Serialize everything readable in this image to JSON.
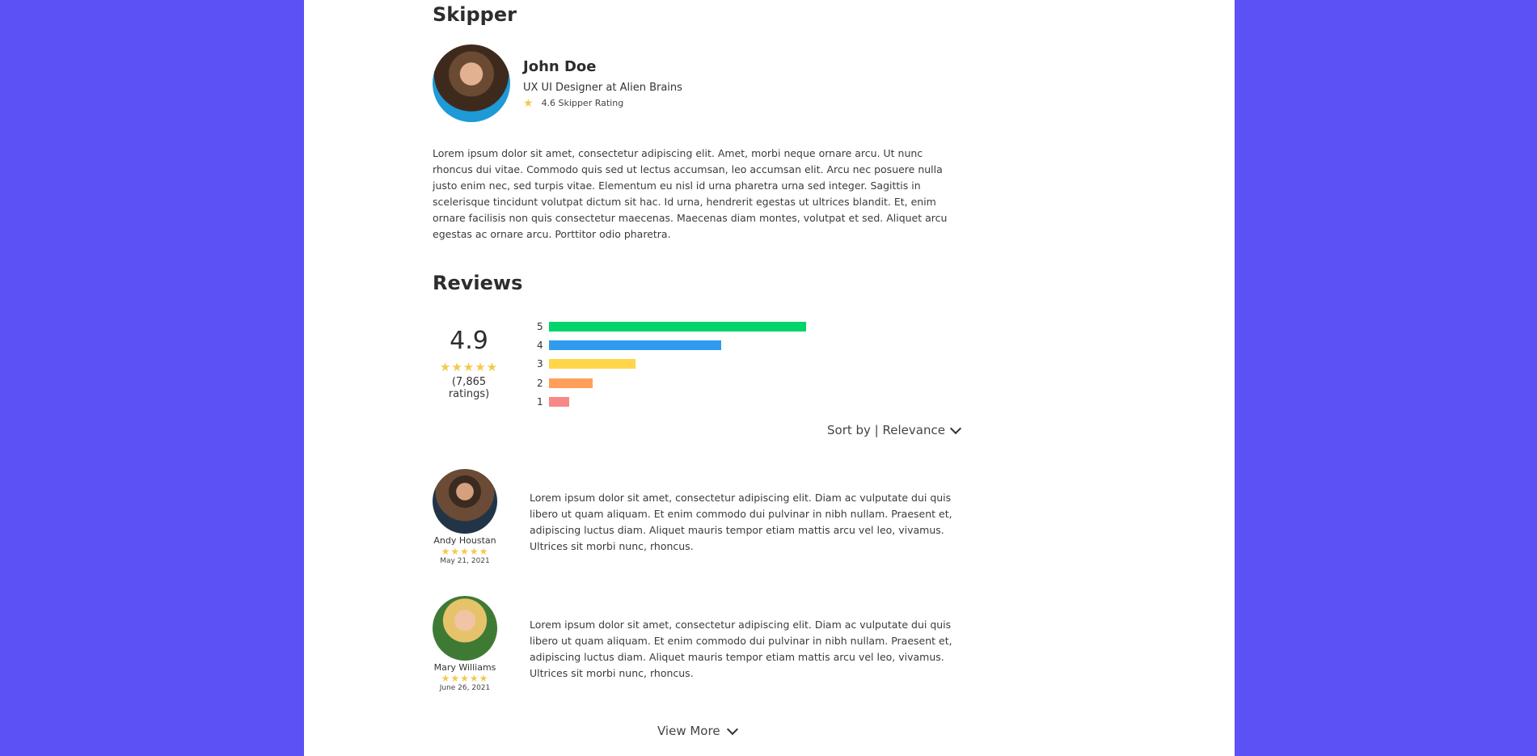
{
  "skipper": {
    "section_title": "Skipper",
    "name": "John Doe",
    "role": "UX UI Designer at Alien Brains",
    "rating_text": "4.6 Skipper Rating",
    "bio": "Lorem ipsum dolor sit amet, consectetur adipiscing elit. Amet, morbi neque ornare arcu. Ut nunc rhoncus dui vitae. Commodo quis sed ut lectus accumsan, leo accumsan elit. Arcu nec posuere nulla justo enim nec, sed turpis vitae. Elementum eu nisl id urna pharetra urna sed integer. Sagittis in scelerisque tincidunt volutpat dictum sit hac. Id urna, hendrerit egestas ut ultrices blandit. Et, enim ornare facilisis non quis consectetur maecenas. Maecenas diam montes, volutpat et sed. Aliquet arcu egestas ac ornare arcu. Porttitor odio pharetra."
  },
  "reviews": {
    "section_title": "Reviews",
    "average": "4.9",
    "stars": "★★★★★",
    "count": "(7,865 ratings)",
    "distribution": [
      {
        "label": "5",
        "fraction": 1.0,
        "color": "#00d46a"
      },
      {
        "label": "4",
        "fraction": 0.67,
        "color": "#2f9bef"
      },
      {
        "label": "3",
        "fraction": 0.335,
        "color": "#ffd54a"
      },
      {
        "label": "2",
        "fraction": 0.17,
        "color": "#ff9f5a"
      },
      {
        "label": "1",
        "fraction": 0.08,
        "color": "#f78888"
      }
    ],
    "sort_label": "Sort by | Relevance",
    "items": [
      {
        "name": "Andy Houstan",
        "stars": "★★★★★",
        "date": "May 21, 2021",
        "text": "Lorem ipsum dolor sit amet, consectetur adipiscing elit. Diam ac vulputate dui quis libero ut quam aliquam. Et enim commodo dui pulvinar in nibh nullam. Praesent et, adipiscing luctus diam. Aliquet mauris tempor etiam mattis arcu vel leo, vivamus. Ultrices sit morbi nunc, rhoncus."
      },
      {
        "name": "Mary Williams",
        "stars": "★★★★★",
        "date": "June 26, 2021",
        "text": "Lorem ipsum dolor sit amet, consectetur adipiscing elit. Diam ac vulputate dui quis libero ut quam aliquam. Et enim commodo dui pulvinar in nibh nullam. Praesent et, adipiscing luctus diam. Aliquet mauris tempor etiam mattis arcu vel leo, vivamus. Ultrices sit morbi nunc, rhoncus."
      }
    ],
    "view_more": "View More"
  }
}
